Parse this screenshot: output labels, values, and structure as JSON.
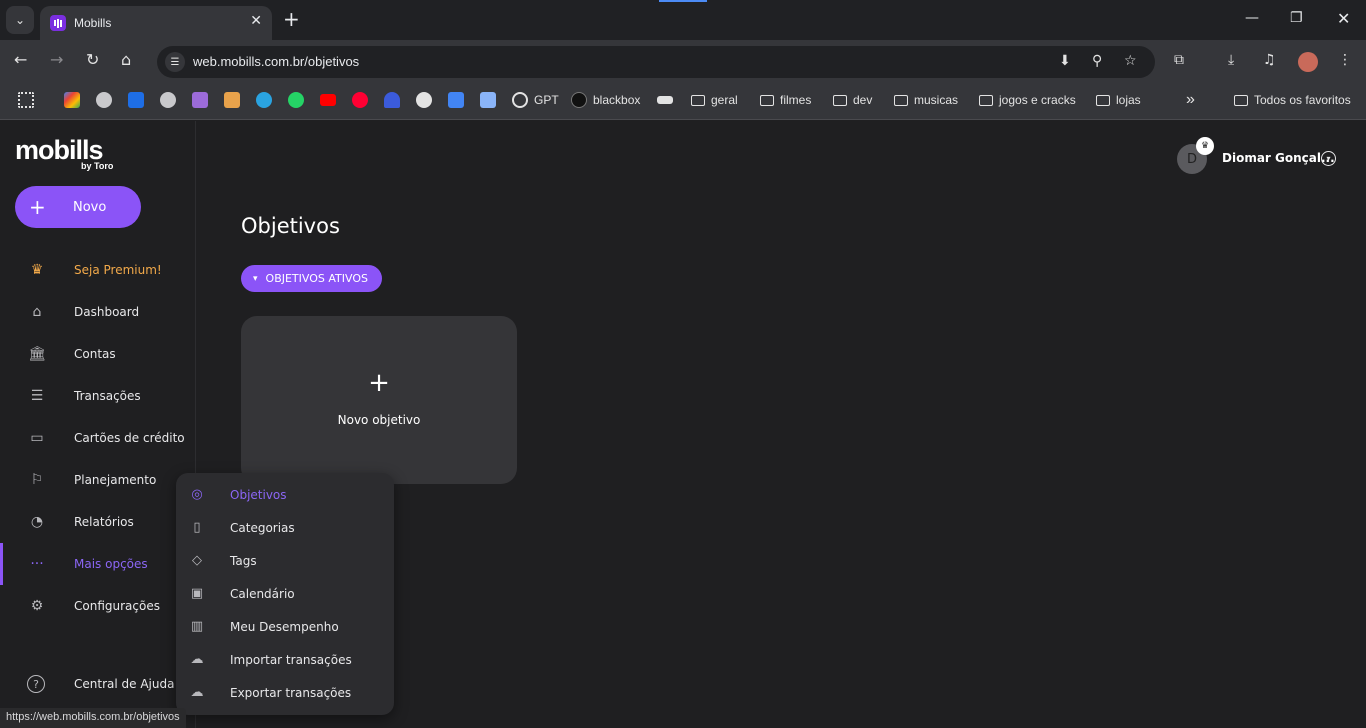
{
  "browser": {
    "tab_title": "Mobills",
    "url": "web.mobills.com.br/objetivos",
    "bookmarks": [
      {
        "label": "",
        "icon": "apps-grid-icon",
        "color": "#e3e3e3"
      },
      {
        "label": "",
        "icon": "gmail-icon",
        "color": "#ea4335"
      },
      {
        "label": "",
        "icon": "globe-icon",
        "color": "#e3e3e3"
      },
      {
        "label": "",
        "icon": "bookmark-blue-icon",
        "color": "#1e6ee6"
      },
      {
        "label": "",
        "icon": "globe-icon",
        "color": "#e3e3e3"
      },
      {
        "label": "",
        "icon": "tv-icon",
        "color": "#9c6bd9"
      },
      {
        "label": "",
        "icon": "store-icon",
        "color": "#e8a24b"
      },
      {
        "label": "",
        "icon": "telegram-icon",
        "color": "#2aa3e0"
      },
      {
        "label": "",
        "icon": "whatsapp-icon",
        "color": "#25d366"
      },
      {
        "label": "",
        "icon": "youtube-icon",
        "color": "#ff0000"
      },
      {
        "label": "",
        "icon": "youtube-music-icon",
        "color": "#ff0033"
      },
      {
        "label": "",
        "icon": "heart-icon",
        "color": "#3b5bdb"
      },
      {
        "label": "",
        "icon": "github-icon",
        "color": "#e3e3e3"
      },
      {
        "label": "",
        "icon": "translate-icon",
        "color": "#4285f4"
      },
      {
        "label": "",
        "icon": "image-icon",
        "color": "#8ab4f8"
      },
      {
        "label": "GPT",
        "icon": "openai-icon",
        "color": "#e3e3e3"
      },
      {
        "label": "blackbox",
        "icon": "blackbox-icon",
        "color": "#e3e3e3"
      },
      {
        "label": "",
        "icon": "amazon-icon",
        "color": "#e3e3e3"
      },
      {
        "label": "geral",
        "icon": "folder-icon",
        "color": "#e3e3e3"
      },
      {
        "label": "filmes",
        "icon": "folder-icon",
        "color": "#e3e3e3"
      },
      {
        "label": "dev",
        "icon": "folder-icon",
        "color": "#e3e3e3"
      },
      {
        "label": "musicas",
        "icon": "folder-icon",
        "color": "#e3e3e3"
      },
      {
        "label": "jogos e cracks",
        "icon": "folder-icon",
        "color": "#e3e3e3"
      },
      {
        "label": "lojas",
        "icon": "folder-icon",
        "color": "#e3e3e3"
      }
    ],
    "all_bookmarks": "Todos os favoritos",
    "status_url": "https://web.mobills.com.br/objetivos"
  },
  "sidebar": {
    "logo": "mobills",
    "logo_sub": "by Toro",
    "new_button": "Novo",
    "items": [
      {
        "label": "Seja Premium!",
        "icon": "crown-icon"
      },
      {
        "label": "Dashboard",
        "icon": "home-icon"
      },
      {
        "label": "Contas",
        "icon": "bank-icon"
      },
      {
        "label": "Transações",
        "icon": "list-icon"
      },
      {
        "label": "Cartões de crédito",
        "icon": "credit-card-icon"
      },
      {
        "label": "Planejamento",
        "icon": "flag-icon"
      },
      {
        "label": "Relatórios",
        "icon": "pie-chart-icon"
      },
      {
        "label": "Mais opções",
        "icon": "more-dots-icon"
      },
      {
        "label": "Configurações",
        "icon": "gear-icon"
      },
      {
        "label": "Central de Ajuda",
        "icon": "help-icon"
      }
    ]
  },
  "header": {
    "avatar_initial": "D",
    "username": "Diomar Gonçal..."
  },
  "main": {
    "title": "Objetivos",
    "filter_label": "OBJETIVOS ATIVOS",
    "new_goal_label": "Novo objetivo"
  },
  "more_menu": {
    "items": [
      {
        "label": "Objetivos",
        "icon": "target-icon"
      },
      {
        "label": "Categorias",
        "icon": "bookmark-icon"
      },
      {
        "label": "Tags",
        "icon": "tag-icon"
      },
      {
        "label": "Calendário",
        "icon": "calendar-icon"
      },
      {
        "label": "Meu Desempenho",
        "icon": "bar-chart-icon"
      },
      {
        "label": "Importar transações",
        "icon": "cloud-upload-icon"
      },
      {
        "label": "Exportar transações",
        "icon": "cloud-download-icon"
      }
    ]
  },
  "colors": {
    "accent": "#8b54f7",
    "premium": "#f2a94a",
    "background": "#1f1f21",
    "card": "#353538"
  }
}
